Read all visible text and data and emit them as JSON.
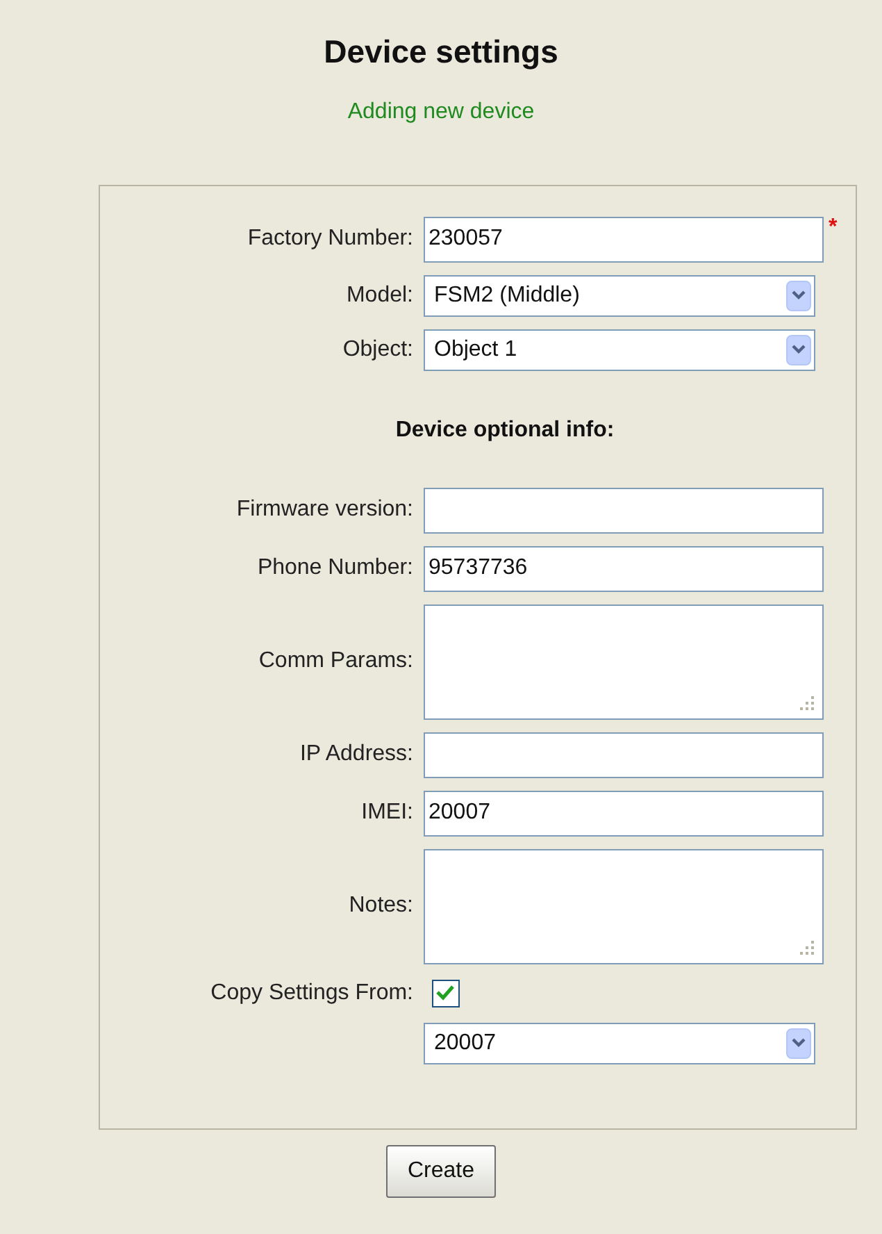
{
  "title": "Device settings",
  "subtitle": "Adding new device",
  "fields": [
    {
      "kind": "text",
      "label": "Factory Number:",
      "value": "230057",
      "required_mark": "*"
    },
    {
      "kind": "select",
      "label": "Model:",
      "value": "FSM2 (Middle)"
    },
    {
      "kind": "select",
      "label": "Object:",
      "value": "Object 1"
    },
    {
      "kind": "heading",
      "label": "Device optional info:"
    },
    {
      "kind": "text",
      "label": "Firmware version:"
    },
    {
      "kind": "text",
      "label": "Phone Number:",
      "value": "95737736"
    },
    {
      "kind": "textarea",
      "label": "Comm Params:"
    },
    {
      "kind": "text",
      "label": "IP Address:"
    },
    {
      "kind": "text",
      "label": "IMEI:",
      "value": "20007"
    },
    {
      "kind": "textarea",
      "label": "Notes:"
    },
    {
      "kind": "checkbox",
      "label": "Copy Settings From:",
      "checked": true
    },
    {
      "kind": "select",
      "value": "20007"
    }
  ],
  "button": "Create"
}
